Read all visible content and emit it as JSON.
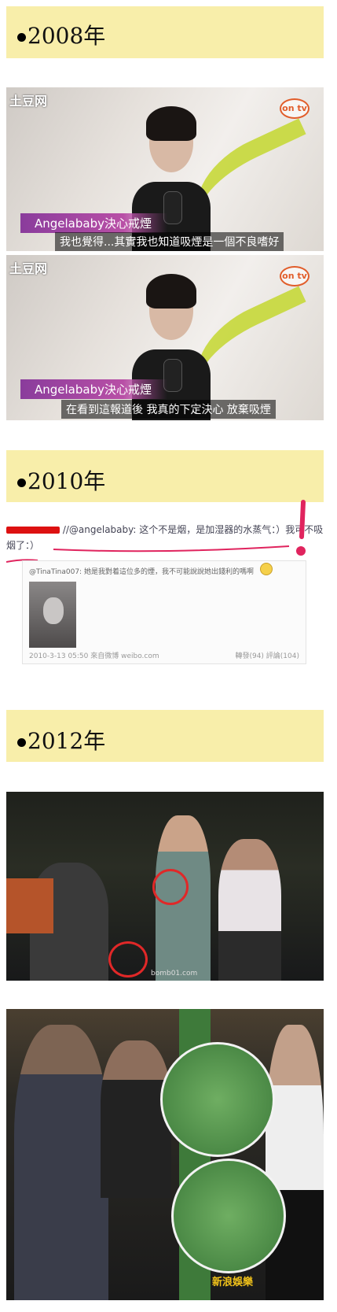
{
  "sections": {
    "year_2008": "2008年",
    "year_2010": "2010年",
    "year_2012": "2012年"
  },
  "video1": {
    "logo_left": "土豆网",
    "logo_right": "on tv",
    "caption_title": "Angelababy決心戒煙",
    "caption_sub": "我也覺得...其實我也知道吸煙是一個不良嗜好"
  },
  "video2": {
    "logo_left": "土豆网",
    "logo_right": "on tv",
    "caption_title": "Angelababy決心戒煙",
    "caption_sub": "在看到這報道後 我真的下定決心 放棄吸煙"
  },
  "weibo": {
    "reply_text": "//@angelababy: 这个不是烟，是加湿器的水蒸气：）我可不吸",
    "reply_text_2": "烟了：）",
    "inner_line": "@TinaTina007: 她是我對着這位多的煙，我不可能說說她出錢利的嗎啊",
    "timestamp": "2010-3-13 05:50  來自微博 weibo.com",
    "stats": "轉發(94)   評論(104)"
  },
  "photo3": {
    "watermark": "bomb01.com"
  },
  "photo4": {
    "watermark": "新浪娛樂"
  },
  "colors": {
    "banner": "#f8eeaa",
    "accent_purple": "#8a3c9c",
    "annotation_red": "#e0245e"
  }
}
